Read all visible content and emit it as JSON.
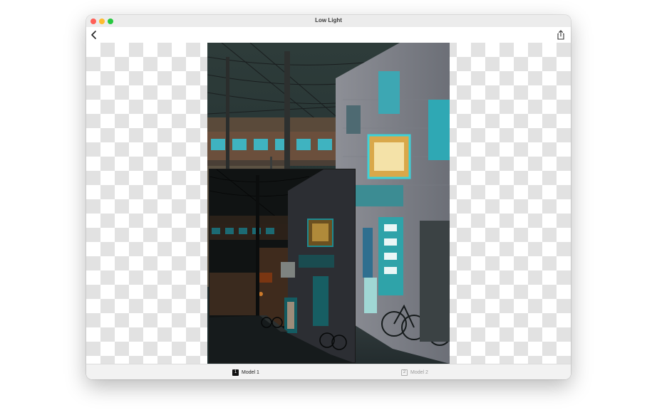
{
  "window": {
    "title": "Low Light"
  },
  "toolbar": {
    "back_icon": "chevron-left-icon",
    "share_icon": "share-icon"
  },
  "photo": {
    "description_icon": "street-scene-enhanced",
    "inset_icon": "street-scene-original"
  },
  "models": [
    {
      "number": "1",
      "label": "Model 1",
      "selected": true
    },
    {
      "number": "2",
      "label": "Model 2",
      "selected": false
    }
  ],
  "colors": {
    "close": "#ff5f57",
    "minimize": "#febc2e",
    "maximize": "#28c840",
    "selected_tab": "#111111"
  }
}
